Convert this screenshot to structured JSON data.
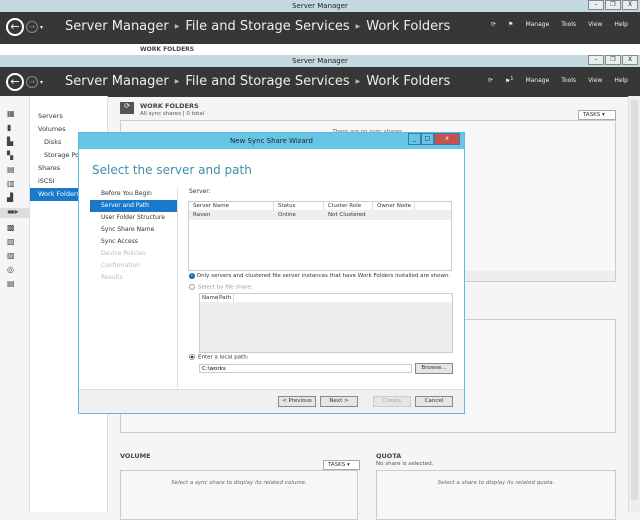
{
  "window": {
    "title": "Server Manager",
    "min": "–",
    "max": "❐",
    "close": "X"
  },
  "header": {
    "breadcrumb": [
      "Server Manager",
      "File and Storage Services",
      "Work Folders"
    ],
    "menu": [
      "Manage",
      "Tools",
      "View",
      "Help"
    ],
    "flag_count": "1"
  },
  "nav": {
    "items": [
      "Servers",
      "Volumes",
      "Disks",
      "Storage Pools",
      "Shares",
      "iSCSI",
      "Work Folders"
    ]
  },
  "work_folders": {
    "title": "WORK FOLDERS",
    "subtitle": "All sync shares | 0 total",
    "tasks": "TASKS",
    "empty": "There are no sync shares."
  },
  "volume": {
    "title": "VOLUME",
    "tasks": "TASKS",
    "empty": "Select a sync share to display its related volume."
  },
  "quota": {
    "title": "QUOTA",
    "subtitle": "No share is selected.",
    "empty": "Select a share to display its related quota."
  },
  "wizard": {
    "title": "New Sync Share Wizard",
    "heading": "Select the server and path",
    "steps": [
      {
        "label": "Before You Begin",
        "state": "normal"
      },
      {
        "label": "Server and Path",
        "state": "selected"
      },
      {
        "label": "User Folder Structure",
        "state": "normal"
      },
      {
        "label": "Sync Share Name",
        "state": "normal"
      },
      {
        "label": "Sync Access",
        "state": "normal"
      },
      {
        "label": "Device Policies",
        "state": "disabled"
      },
      {
        "label": "Confirmation",
        "state": "disabled"
      },
      {
        "label": "Results",
        "state": "disabled"
      }
    ],
    "server_label": "Server:",
    "server_columns": [
      "Server Name",
      "Status",
      "Cluster Role",
      "Owner Node"
    ],
    "server_rows": [
      [
        "Raven",
        "Online",
        "Not Clustered",
        ""
      ]
    ],
    "info": "Only servers and clustered file server instances that have Work Folders installed are shown.",
    "select_share_label": "Select by file share:",
    "share_columns": [
      "Name",
      "Path"
    ],
    "local_path_label": "Enter a local path:",
    "local_path_value": "C:\\works",
    "browse": "Browse...",
    "buttons": {
      "previous": "< Previous",
      "next": "Next >",
      "create": "Create",
      "cancel": "Cancel"
    }
  }
}
